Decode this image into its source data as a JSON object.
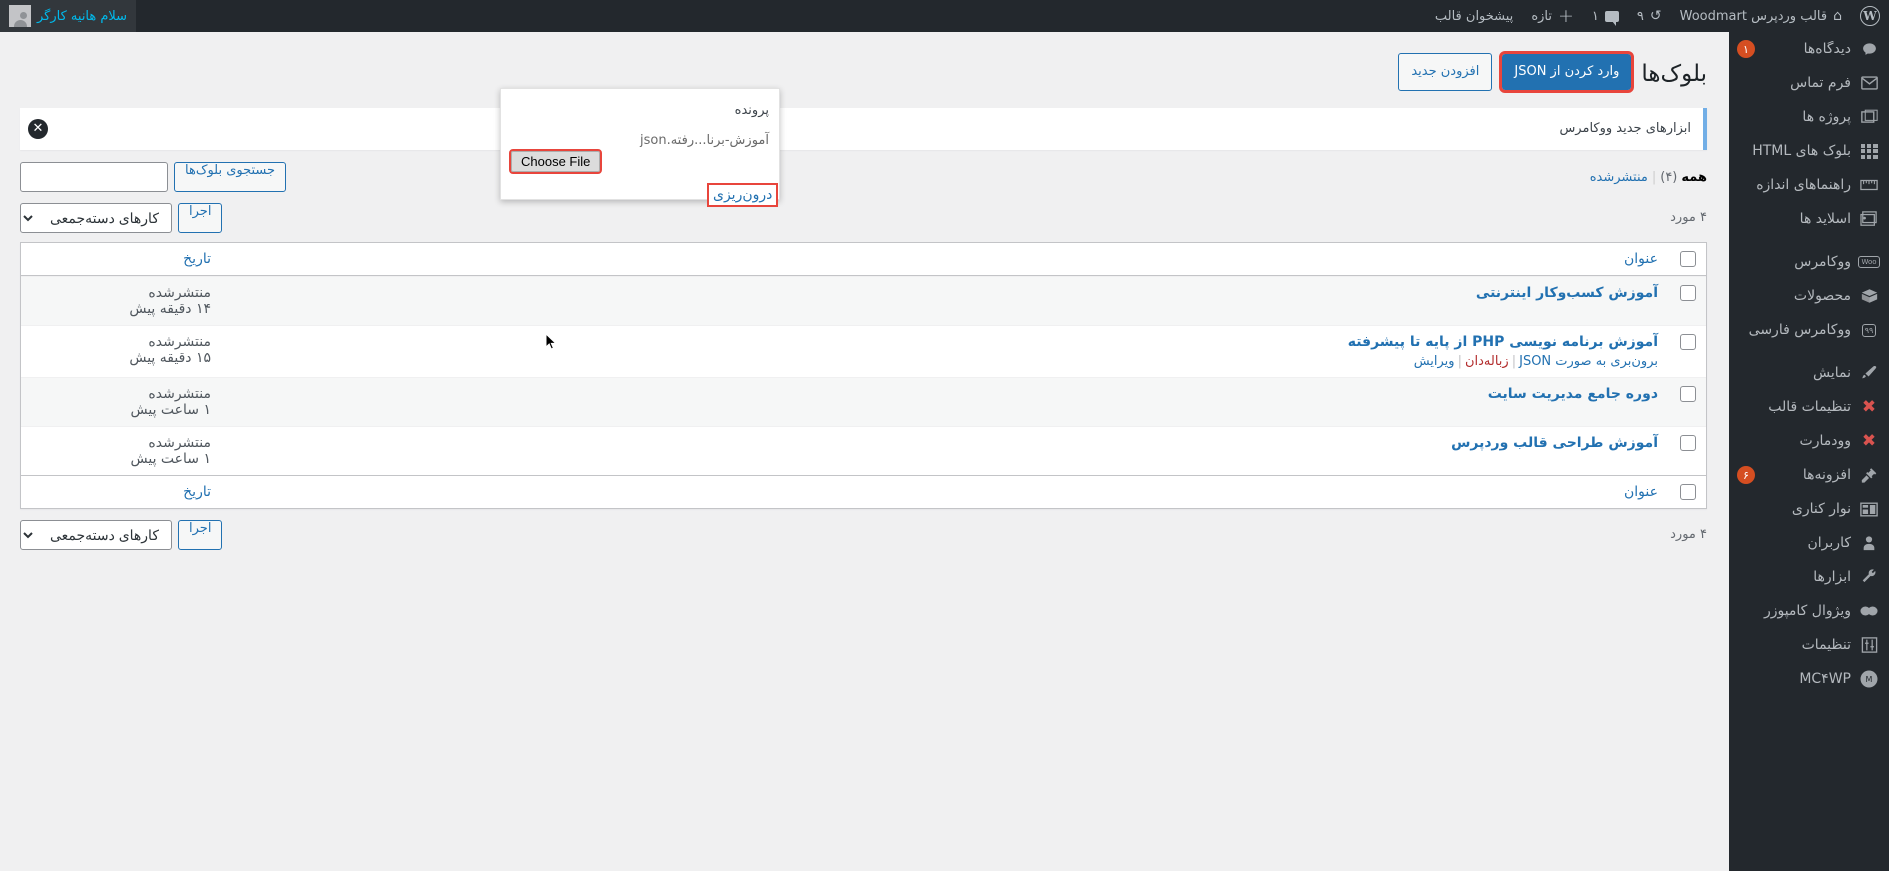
{
  "adminbar": {
    "logo_icon": "wordpress-logo-icon",
    "right_items": [
      {
        "name": "site-name",
        "label": "قالب وردپرس Woodmart",
        "icon": "home-icon"
      },
      {
        "name": "updates",
        "label": "۹",
        "icon": "refresh-icon"
      },
      {
        "name": "comments",
        "label": "۱",
        "icon": "comment-bubble-icon"
      },
      {
        "name": "new-content",
        "label": "تازه",
        "icon": "plus-icon"
      },
      {
        "name": "theme-panel",
        "label": "پیشخوان قالب",
        "icon": ""
      }
    ],
    "account": {
      "greeting": "سلام هانیه کارگر",
      "avatar": "user-avatar"
    }
  },
  "sidebar": {
    "items": [
      {
        "label": "دیدگاه‌ها",
        "icon": "comment-icon",
        "badge": "۱"
      },
      {
        "label": "فرم تماس",
        "icon": "envelope-icon",
        "badge": ""
      },
      {
        "label": "پروژه ها",
        "icon": "portfolio-icon",
        "badge": ""
      },
      {
        "label": "بلوک های HTML",
        "icon": "blocks-grid-icon",
        "badge": ""
      },
      {
        "label": "راهنماهای اندازه",
        "icon": "size-guide-icon",
        "badge": ""
      },
      {
        "label": "اسلاید ها",
        "icon": "slides-icon",
        "badge": ""
      },
      {
        "label": "ووکامرس",
        "icon": "woocommerce-icon",
        "badge": ""
      },
      {
        "label": "محصولات",
        "icon": "products-box-icon",
        "badge": ""
      },
      {
        "label": "ووکامرس فارسی",
        "icon": "woo-persian-icon",
        "badge": ""
      },
      {
        "label": "نمایش",
        "icon": "appearance-brush-icon",
        "badge": ""
      },
      {
        "label": "تنظیمات قالب",
        "icon": "theme-settings-x-icon",
        "badge": ""
      },
      {
        "label": "وودمارت",
        "icon": "woodmart-x-icon",
        "badge": ""
      },
      {
        "label": "افزونه‌ها",
        "icon": "plugin-plug-icon",
        "badge": "۶"
      },
      {
        "label": "نوار کناری",
        "icon": "sidebar-layout-icon",
        "badge": ""
      },
      {
        "label": "کاربران",
        "icon": "users-person-icon",
        "badge": ""
      },
      {
        "label": "ابزارها",
        "icon": "tools-wrench-icon",
        "badge": ""
      },
      {
        "label": "ویژوال کامپوزر",
        "icon": "visual-composer-icon",
        "badge": ""
      },
      {
        "label": "تنظیمات",
        "icon": "settings-sliders-icon",
        "badge": ""
      },
      {
        "label": "MC۴WP",
        "icon": "mailchimp-icon",
        "badge": ""
      }
    ]
  },
  "page": {
    "title": "بلوک‌ها",
    "add_new_label": "افزودن جدید",
    "import_json_label": "وارد کردن از JSON"
  },
  "notice": {
    "text": "ابزارهای جدید ووکامرس",
    "dismiss_icon": "close-circle-icon"
  },
  "filters": {
    "all_label": "همه",
    "all_count": "(۴)",
    "published_label": "منتشرشده",
    "separator": "|",
    "search_placeholder": "",
    "search_value": "",
    "search_button": "جستجوی بلوک‌ها"
  },
  "tablenav_top": {
    "bulk_select_label": "کارهای دسته‌جمعی",
    "apply_label": "اجرا",
    "displaying_num": "۴ مورد"
  },
  "tablenav_bottom": {
    "bulk_select_label": "کارهای دسته‌جمعی",
    "apply_label": "اجرا",
    "displaying_num": "۴ مورد"
  },
  "table": {
    "columns": {
      "title": "عنوان",
      "date": "تاریخ"
    },
    "rows": [
      {
        "title": "آموزش کسب‌وکار اینترنتی",
        "date_status": "منتشرشده",
        "date_ago": "۱۴ دقیقه پیش",
        "actions": []
      },
      {
        "title": "آموزش برنامه نویسی PHP از پایه تا پیشرفته",
        "date_status": "منتشرشده",
        "date_ago": "۱۵ دقیقه پیش",
        "actions": [
          {
            "label": "ویرایش",
            "kind": "edit"
          },
          {
            "label": "زباله‌دان",
            "kind": "trash"
          },
          {
            "label": "برون‌بری به صورت JSON",
            "kind": "export"
          }
        ]
      },
      {
        "title": "دوره جامع مدیریت سایت",
        "date_status": "منتشرشده",
        "date_ago": "۱ ساعت پیش",
        "actions": []
      },
      {
        "title": "آموزش طراحی قالب وردپرس",
        "date_status": "منتشرشده",
        "date_ago": "۱ ساعت پیش",
        "actions": []
      }
    ]
  },
  "import_popup": {
    "file_label": "پرونده",
    "filename": "آموزش-برنا...رفته.json",
    "choose_file_label": "Choose File",
    "submit_label": "درون‌ریزی"
  },
  "colors": {
    "accent": "#2271b1",
    "admin_bg": "#23282d",
    "highlight_red": "#e8453c",
    "badge_orange": "#d54e21",
    "trash_red": "#b32d2e"
  }
}
